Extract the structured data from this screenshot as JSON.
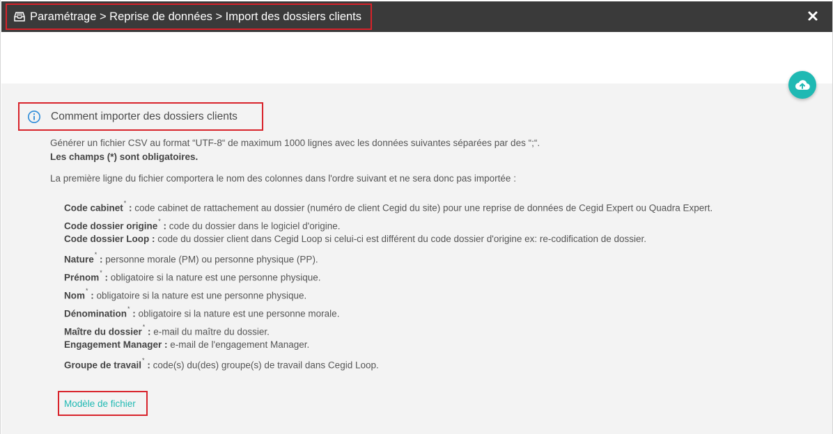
{
  "titlebar": {
    "breadcrumb": "Paramétrage > Reprise de données > Import des dossiers clients",
    "icon": "inbox-tray-icon",
    "close_icon": "close-icon"
  },
  "upload": {
    "icon": "cloud-upload-icon",
    "color": "#1fb9b3"
  },
  "help": {
    "title": "Comment importer des dossiers clients",
    "line1": "Générer un fichier CSV au format “UTF-8“ de maximum 1000 lignes avec les données suivantes séparées par des “;“.",
    "line2": "Les champs (*) sont obligatoires.",
    "line3": "La première ligne du fichier comportera le nom des colonnes dans l'ordre suivant et ne sera donc pas importée :"
  },
  "fields": [
    {
      "name": "Code cabinet",
      "required": "*",
      "desc": " : code cabinet de rattachement au dossier (numéro de client Cegid du site) pour une reprise de données de Cegid Expert ou Quadra Expert."
    },
    {
      "name": "Code dossier origine",
      "required": "*",
      "desc": " : code du dossier dans le logiciel d'origine."
    },
    {
      "name": "Code dossier Loop",
      "required": "",
      "desc": " : code du dossier client dans Cegid Loop si celui-ci est différent du code dossier d'origine ex: re-codification de dossier."
    },
    {
      "name": "Nature",
      "required": "*",
      "desc": " : personne morale (PM) ou personne physique (PP)."
    },
    {
      "name": "Prénom",
      "required": "*",
      "desc": " : obligatoire si la nature est une personne physique."
    },
    {
      "name": "Nom",
      "required": "*",
      "desc": " : obligatoire si la nature est une personne physique."
    },
    {
      "name": "Dénomination",
      "required": "*",
      "desc": " : obligatoire si la nature est une personne morale."
    },
    {
      "name": "Maître du dossier",
      "required": "*",
      "desc": " : e-mail du maître du dossier."
    },
    {
      "name": "Engagement Manager",
      "required": "",
      "desc": " : e-mail de l'engagement Manager."
    },
    {
      "name": "Groupe de travail",
      "required": "*",
      "desc": " : code(s) du(des) groupe(s) de travail dans Cegid Loop."
    }
  ],
  "template_link": "Modèle de fichier",
  "colors": {
    "highlight": "#d8222a",
    "accent": "#1fb9b3",
    "titlebar": "#3a3a3a"
  }
}
